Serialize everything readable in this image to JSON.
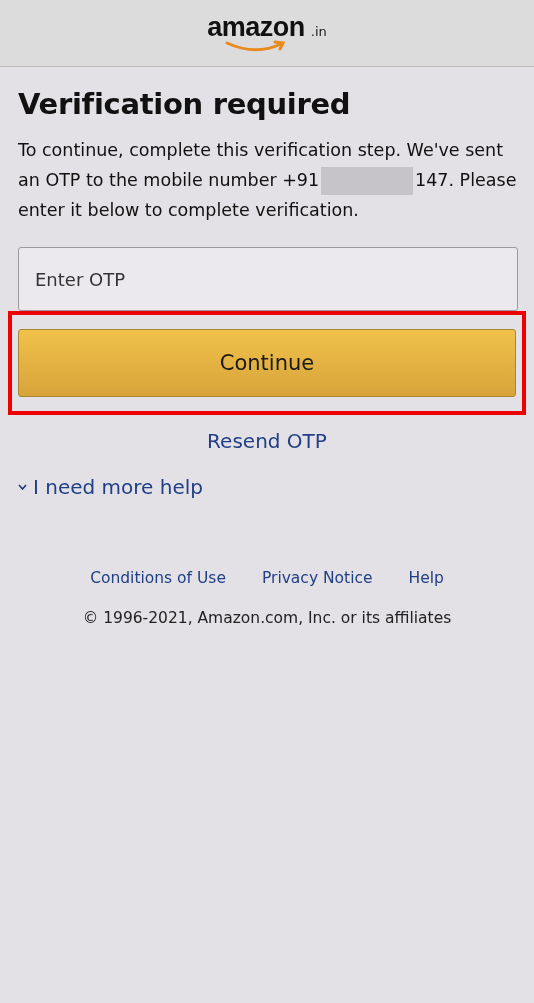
{
  "header": {
    "logo_text": "amazon",
    "logo_suffix": ".in"
  },
  "title": "Verification required",
  "message": {
    "before": "To continue, complete this verification step. We've sent an OTP to the mobile number +91",
    "redacted": true,
    "after": "147. Please enter it below to complete verification."
  },
  "otp_field": {
    "placeholder": "Enter OTP"
  },
  "continue_button": {
    "label": "Continue",
    "highlighted": true
  },
  "resend_link": "Resend OTP",
  "help_toggle": {
    "label": "I need more help",
    "expanded": false
  },
  "footer": {
    "links": [
      "Conditions of Use",
      "Privacy Notice",
      "Help"
    ],
    "copyright": "© 1996-2021, Amazon.com, Inc. or its affiliates"
  }
}
